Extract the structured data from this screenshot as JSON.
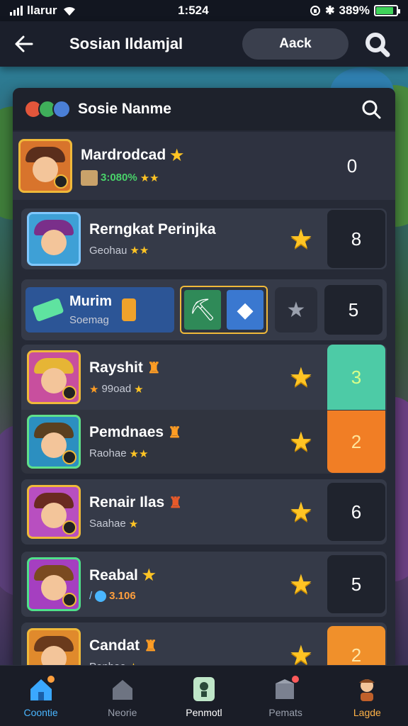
{
  "status_bar": {
    "carrier": "llarur",
    "time": "1:524",
    "battery_text": "389%",
    "battery_level": 0.85,
    "icons": [
      "signal-icon",
      "wifi-icon",
      "lock-rotation-icon",
      "bluetooth-icon",
      "battery-icon"
    ]
  },
  "app_bar": {
    "title": "Sosian Ildamjal",
    "add_label": "Aack"
  },
  "panel": {
    "title": "Sosie Nanme"
  },
  "rows": [
    {
      "name": "Mardrodcad",
      "sub": "3:080%",
      "rank": "0"
    },
    {
      "name": "Rerngkat Perinjka",
      "sub": "Geohau",
      "rank": "8"
    },
    {
      "name": "Murim",
      "sub": "Soemag",
      "rank": "5"
    },
    {
      "name": "Rayshit",
      "sub": "99oad",
      "rank": "3"
    },
    {
      "name": "Pemdnaes",
      "sub": "Raohae",
      "rank": "2"
    },
    {
      "name": "Renair Ilas",
      "sub": "Saahae",
      "rank": "6"
    },
    {
      "name": "Reabal",
      "sub": "3.106",
      "rank": "5"
    },
    {
      "name": "Candat",
      "sub": "Penhae",
      "rank": "2"
    }
  ],
  "bottom_nav": [
    {
      "label": "Coontie",
      "icon": "home-icon"
    },
    {
      "label": "Neorie",
      "icon": "house-icon"
    },
    {
      "label": "Penmotl",
      "icon": "profile-icon"
    },
    {
      "label": "Pemats",
      "icon": "box-icon"
    },
    {
      "label": "Lagde",
      "icon": "character-icon"
    }
  ],
  "colors": {
    "accent": "#4ab6ff",
    "star": "#ffc424",
    "rank_teal": "#4dcba6",
    "rank_orange": "#f17e25"
  }
}
